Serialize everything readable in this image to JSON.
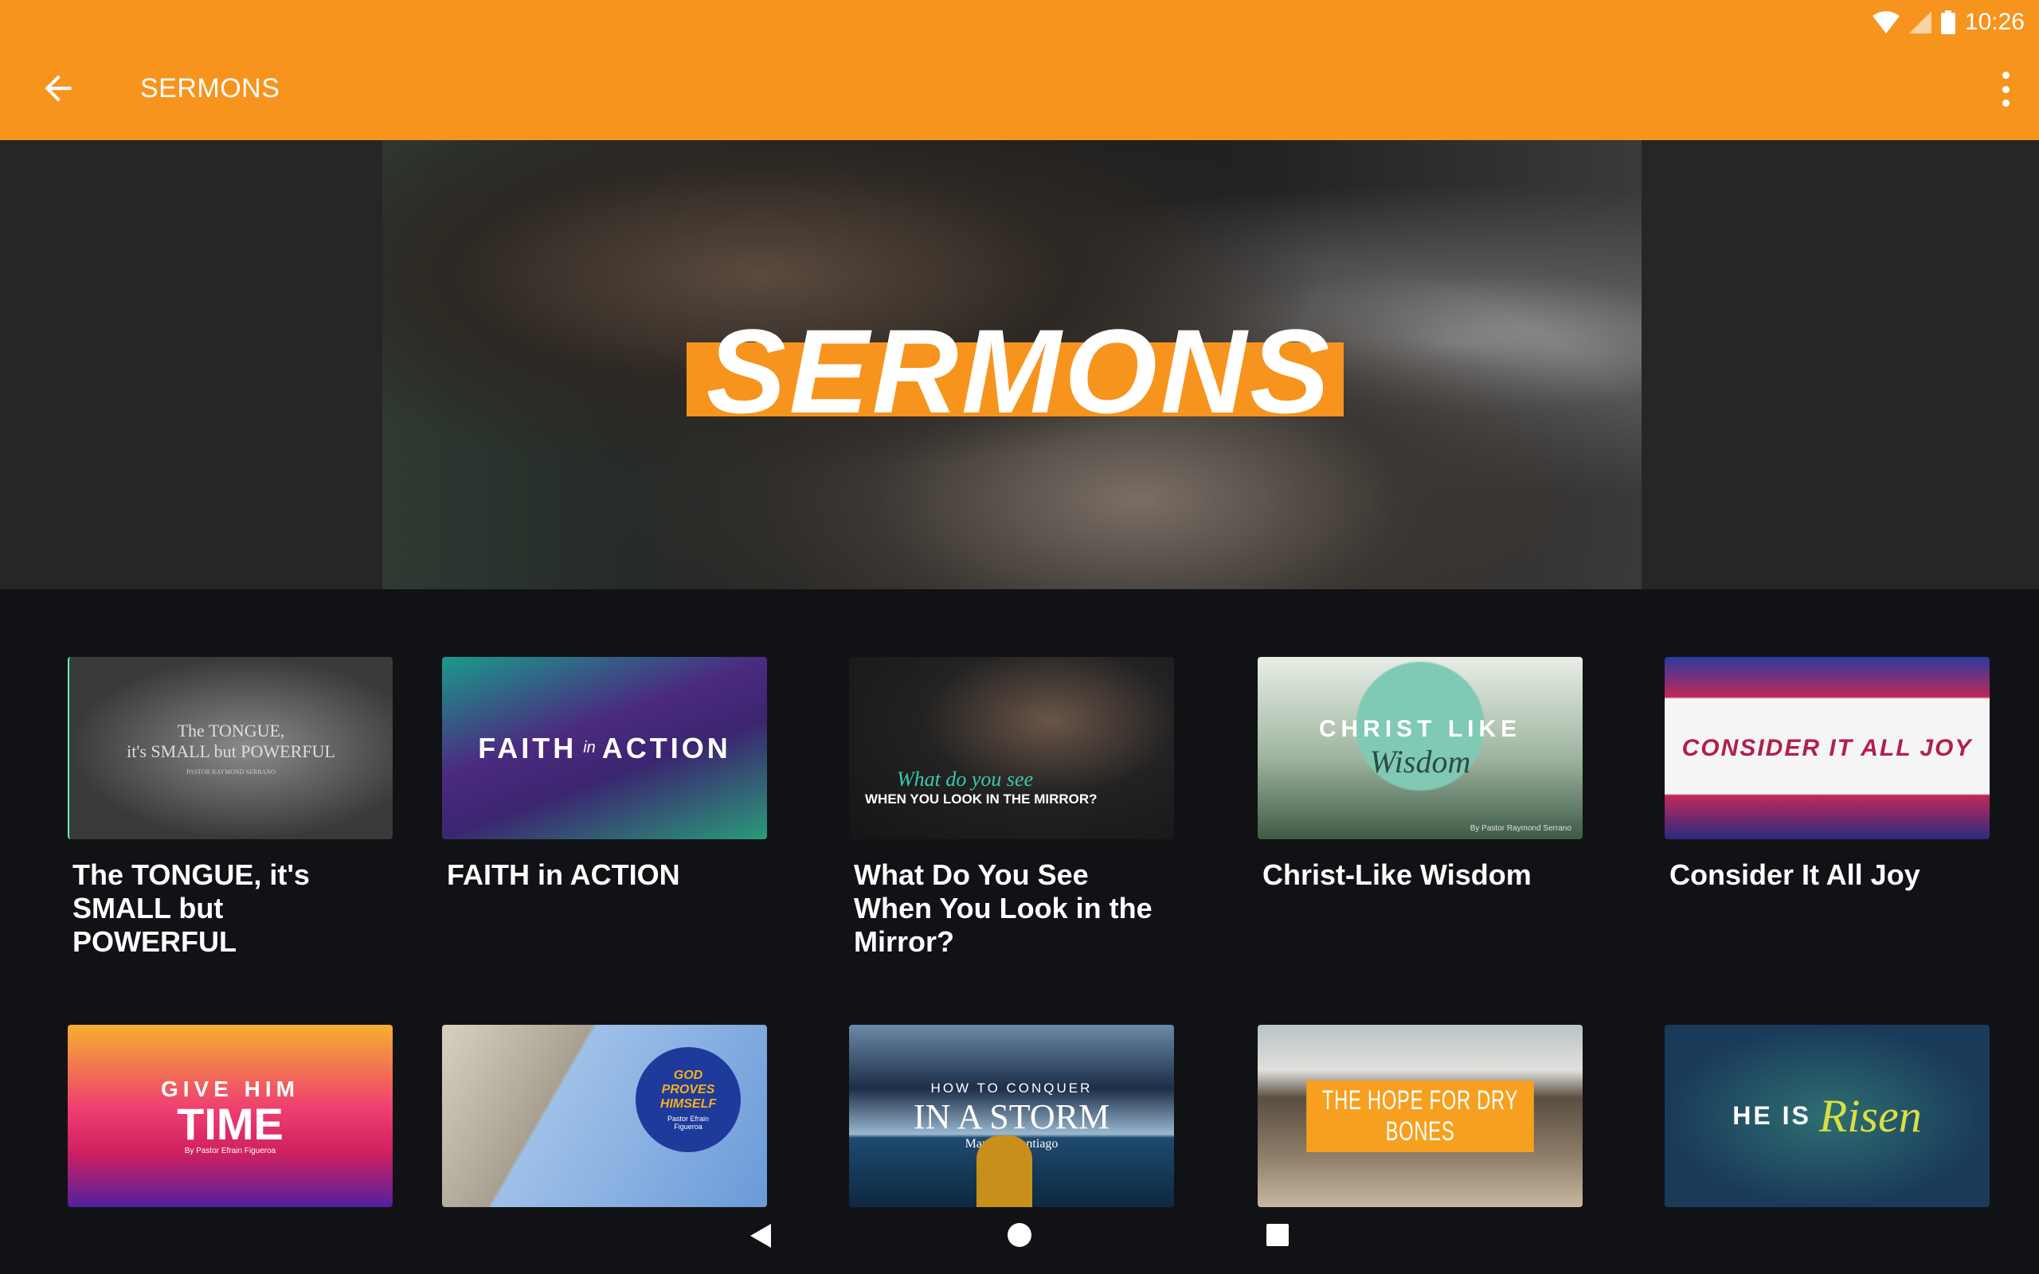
{
  "status_bar": {
    "time": "10:26"
  },
  "app_bar": {
    "title": "SERMONS"
  },
  "hero": {
    "banner_text": "SERMONS",
    "accent": "#F7941D"
  },
  "sermons": [
    {
      "title": "The TONGUE, it's SMALL but POWERFUL",
      "thumb_line1": "The TONGUE,",
      "thumb_line2": "it's SMALL but POWERFUL",
      "thumb_line3": "PASTOR RAYMOND SERRANO"
    },
    {
      "title": "FAITH in ACTION",
      "thumb_line1": "FAITH",
      "thumb_line2": "in",
      "thumb_line3": "ACTION"
    },
    {
      "title": "What Do You See When You Look in the Mirror?",
      "thumb_line1": "What do you see",
      "thumb_line2": "WHEN YOU LOOK IN THE MIRROR?"
    },
    {
      "title": "Christ-Like Wisdom",
      "thumb_line1": "CHRIST LIKE",
      "thumb_line2": "Wisdom",
      "thumb_line3": "By Pastor Raymond Serrano"
    },
    {
      "title": "Consider It All Joy",
      "thumb_line1": "CONSIDER IT ALL JOY"
    },
    {
      "title": "",
      "thumb_line1": "GIVE HIM",
      "thumb_line2": "TIME",
      "thumb_line3": "By Pastor Efrain Figueroa"
    },
    {
      "title": "",
      "thumb_line1": "GOD",
      "thumb_line2": "PROVES",
      "thumb_line3": "HIMSELF",
      "thumb_line4": "Pastor Efrain Figueroa"
    },
    {
      "title": "",
      "thumb_line1": "HOW TO CONQUER",
      "thumb_line2": "IN A STORM",
      "thumb_line3": "Maureen Santiago"
    },
    {
      "title": "",
      "thumb_line1": "THE HOPE FOR DRY BONES"
    },
    {
      "title": "",
      "thumb_line1": "HE IS",
      "thumb_line2": "Risen"
    }
  ]
}
